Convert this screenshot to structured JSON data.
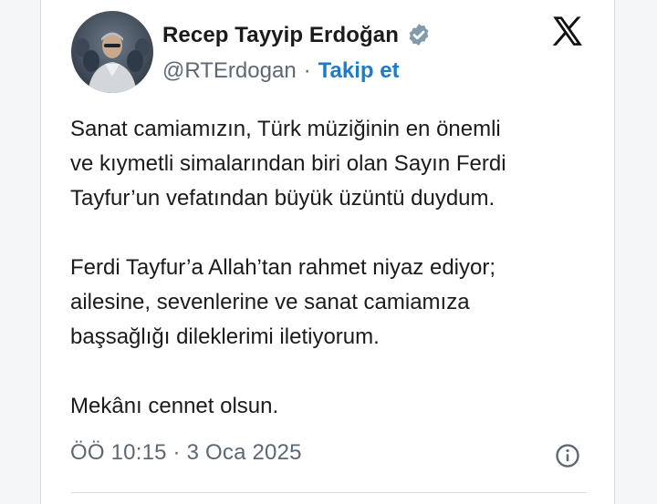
{
  "post": {
    "display_name": "Recep Tayyip Erdoğan",
    "handle": "@RTErdogan",
    "separator": "·",
    "follow_label": "Takip et",
    "paragraphs": [
      "Sanat camiamızın, Türk müziğinin en önemli\nve kıymetli simalarından biri olan Sayın Ferdi\nTayfur’un vefatından büyük üzüntü duydum.",
      "Ferdi Tayfur’a Allah’tan rahmet niyaz ediyor;\nailesine, sevenlerine ve sanat camiamıza\nbaşsağlığı dileklerimi iletiyorum.",
      "Mekânı cennet olsun."
    ],
    "timestamp": "ÖÖ 10:15 · 3 Oca 2025"
  },
  "icons": {
    "verified": "verified-badge-icon",
    "platform": "x-logo-icon",
    "info": "info-icon"
  },
  "colors": {
    "link": "#1d7bc8",
    "muted_text": "#5c6873",
    "verified_badge": "#829aab"
  }
}
